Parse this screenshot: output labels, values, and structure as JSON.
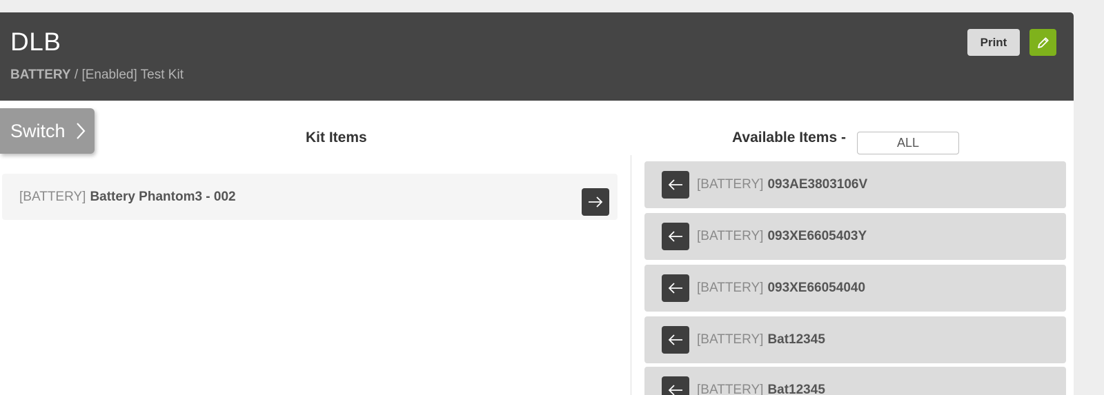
{
  "header": {
    "title": "DLB",
    "breadcrumb_category": "BATTERY",
    "breadcrumb_separator": " / ",
    "breadcrumb_rest": "[Enabled] Test Kit",
    "print_label": "Print",
    "edit_icon": "pencil-icon"
  },
  "switch": {
    "label": "Switch",
    "icon": "chevron-right-icon"
  },
  "kit_items": {
    "title": "Kit Items",
    "items": [
      {
        "category": "[BATTERY]",
        "name": "Battery Phantom3 - 002",
        "icon": "arrow-right-icon"
      }
    ]
  },
  "available_items": {
    "title": "Available Items -",
    "filter_value": "ALL",
    "items": [
      {
        "category": "[BATTERY]",
        "name": "093AE3803106V",
        "icon": "arrow-left-icon"
      },
      {
        "category": "[BATTERY]",
        "name": "093XE6605403Y",
        "icon": "arrow-left-icon"
      },
      {
        "category": "[BATTERY]",
        "name": "093XE66054040",
        "icon": "arrow-left-icon"
      },
      {
        "category": "[BATTERY]",
        "name": "Bat12345",
        "icon": "arrow-left-icon"
      },
      {
        "category": "[BATTERY]",
        "name": "Bat12345",
        "icon": "arrow-left-icon"
      }
    ]
  },
  "colors": {
    "header_bg": "#454545",
    "accent_green": "#7fb21c",
    "available_row_bg": "#dcdcdc",
    "kit_row_bg": "#f5f5f5"
  }
}
